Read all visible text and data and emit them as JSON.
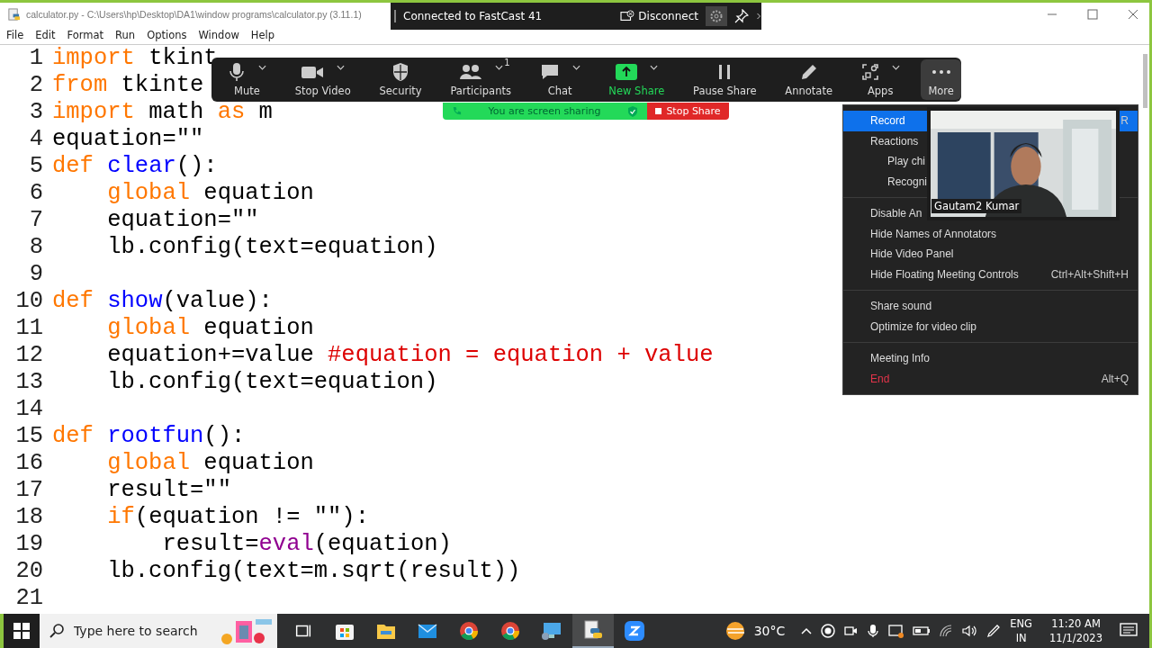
{
  "window": {
    "title": "calculator.py - C:\\Users\\hp\\Desktop\\DA1\\window programs\\calculator.py (3.11.1)",
    "menu": [
      "File",
      "Edit",
      "Format",
      "Run",
      "Options",
      "Window",
      "Help"
    ]
  },
  "cast_bar": {
    "status": "Connected to FastCast 41",
    "disconnect": "Disconnect"
  },
  "editor": {
    "lines": [
      {
        "number": "1",
        "tokens": [
          {
            "text": "import",
            "kind": "keyword"
          },
          {
            "text": " tkint",
            "kind": "plain"
          }
        ]
      },
      {
        "number": "2",
        "tokens": [
          {
            "text": "from",
            "kind": "keyword"
          },
          {
            "text": " tkinte",
            "kind": "plain"
          }
        ]
      },
      {
        "number": "3",
        "tokens": [
          {
            "text": "import",
            "kind": "keyword"
          },
          {
            "text": " math ",
            "kind": "plain"
          },
          {
            "text": "as",
            "kind": "keyword"
          },
          {
            "text": " m",
            "kind": "plain"
          }
        ]
      },
      {
        "number": "4",
        "tokens": [
          {
            "text": "equation=\"\"",
            "kind": "plain"
          }
        ]
      },
      {
        "number": "5",
        "tokens": [
          {
            "text": "def ",
            "kind": "keyword"
          },
          {
            "text": "clear",
            "kind": "definition"
          },
          {
            "text": "():",
            "kind": "plain"
          }
        ]
      },
      {
        "number": "6",
        "tokens": [
          {
            "text": "    global",
            "kind": "keyword"
          },
          {
            "text": " equation",
            "kind": "plain"
          }
        ]
      },
      {
        "number": "7",
        "tokens": [
          {
            "text": "    equation=\"\"",
            "kind": "plain"
          }
        ]
      },
      {
        "number": "8",
        "tokens": [
          {
            "text": "    lb.config(text=equation)",
            "kind": "plain"
          }
        ]
      },
      {
        "number": "9"
      },
      {
        "number": "10",
        "tokens": [
          {
            "text": "def ",
            "kind": "keyword"
          },
          {
            "text": "show",
            "kind": "definition"
          },
          {
            "text": "(value):",
            "kind": "plain"
          }
        ]
      },
      {
        "number": "11",
        "tokens": [
          {
            "text": "    global",
            "kind": "keyword"
          },
          {
            "text": " equation",
            "kind": "plain"
          }
        ]
      },
      {
        "number": "12",
        "tokens": [
          {
            "text": "    equation+=value ",
            "kind": "plain"
          },
          {
            "text": "#equation = equation + value",
            "kind": "comment"
          }
        ]
      },
      {
        "number": "13",
        "tokens": [
          {
            "text": "    lb.config(text=equation)",
            "kind": "plain"
          }
        ]
      },
      {
        "number": "14"
      },
      {
        "number": "15",
        "tokens": [
          {
            "text": "def ",
            "kind": "keyword"
          },
          {
            "text": "rootfun",
            "kind": "definition"
          },
          {
            "text": "():",
            "kind": "plain"
          }
        ]
      },
      {
        "number": "16",
        "tokens": [
          {
            "text": "    global",
            "kind": "keyword"
          },
          {
            "text": " equation",
            "kind": "plain"
          }
        ]
      },
      {
        "number": "17",
        "tokens": [
          {
            "text": "    result=\"\"",
            "kind": "plain"
          }
        ]
      },
      {
        "number": "18",
        "tokens": [
          {
            "text": "    if",
            "kind": "keyword"
          },
          {
            "text": "(equation != \"\"):",
            "kind": "plain"
          }
        ]
      },
      {
        "number": "19",
        "tokens": [
          {
            "text": "        result=",
            "kind": "plain"
          },
          {
            "text": "eval",
            "kind": "builtin"
          },
          {
            "text": "(equation)",
            "kind": "plain"
          }
        ]
      },
      {
        "number": "20",
        "tokens": [
          {
            "text": "    lb.config(text=m.sqrt(result))",
            "kind": "plain"
          }
        ]
      },
      {
        "number": "21"
      }
    ]
  },
  "meeting_toolbar": {
    "buttons": [
      {
        "kind": "mic",
        "label": "Mute",
        "caret": true,
        "selected": false
      },
      {
        "kind": "video",
        "label": "Stop Video",
        "caret": true,
        "selected": false
      },
      {
        "kind": "shield",
        "label": "Security",
        "caret": false,
        "selected": false
      },
      {
        "kind": "people",
        "label": "Participants",
        "badge": "1",
        "caret": true,
        "selected": false
      },
      {
        "kind": "chat",
        "label": "Chat",
        "caret": true,
        "selected": false
      },
      {
        "kind": "share",
        "label": "New Share",
        "caret": true,
        "selected": false
      },
      {
        "kind": "pause",
        "label": "Pause Share",
        "caret": false,
        "selected": false
      },
      {
        "kind": "pen",
        "label": "Annotate",
        "caret": false,
        "selected": false
      },
      {
        "kind": "apps",
        "label": "Apps",
        "caret": true,
        "selected": false
      },
      {
        "kind": "dots",
        "label": "More",
        "caret": false,
        "selected": true
      }
    ],
    "banner": "You are screen sharing",
    "stop_share": "Stop Share"
  },
  "more_menu": {
    "groups": [
      [
        {
          "label": "Record",
          "shortcut": "R",
          "kind": "normal",
          "selected": true
        },
        {
          "label": "Reactions",
          "kind": "normal",
          "selected": false
        },
        {
          "label": "Play chi",
          "kind": "sub",
          "selected": false
        },
        {
          "label": "Recogni",
          "kind": "sub",
          "selected": false
        }
      ],
      [
        {
          "label": "Disable An",
          "kind": "normal",
          "selected": false
        },
        {
          "label": "Hide Names of Annotators",
          "kind": "normal",
          "selected": false
        },
        {
          "label": "Hide Video Panel",
          "kind": "normal",
          "selected": false
        },
        {
          "label": "Hide Floating Meeting Controls",
          "shortcut": "Ctrl+Alt+Shift+H",
          "kind": "normal",
          "selected": false
        }
      ],
      [
        {
          "label": "Share sound",
          "kind": "normal",
          "selected": false
        },
        {
          "label": "Optimize for video clip",
          "kind": "normal",
          "selected": false
        }
      ],
      [
        {
          "label": "Meeting Info",
          "kind": "normal",
          "selected": false
        },
        {
          "label": "End",
          "shortcut": "Alt+Q",
          "kind": "danger",
          "selected": false
        }
      ]
    ]
  },
  "video_tile": {
    "kind": "picture",
    "name": "Gautam2 Kumar"
  },
  "taskbar": {
    "search": {
      "placeholder": "Type here to search"
    },
    "apps": [
      {
        "kind": "taskview",
        "selected": false
      },
      {
        "kind": "store",
        "selected": false
      },
      {
        "kind": "folder",
        "selected": false
      },
      {
        "kind": "mail",
        "selected": false
      },
      {
        "kind": "chrome",
        "selected": false
      },
      {
        "kind": "chrome",
        "selected": false
      },
      {
        "kind": "remote",
        "selected": false
      },
      {
        "kind": "python",
        "selected": true
      },
      {
        "kind": "zoom",
        "selected": false
      }
    ],
    "temperature": "30°C",
    "language": "ENG",
    "region": "IN",
    "time": "11:20 AM",
    "date": "11/1/2023"
  }
}
